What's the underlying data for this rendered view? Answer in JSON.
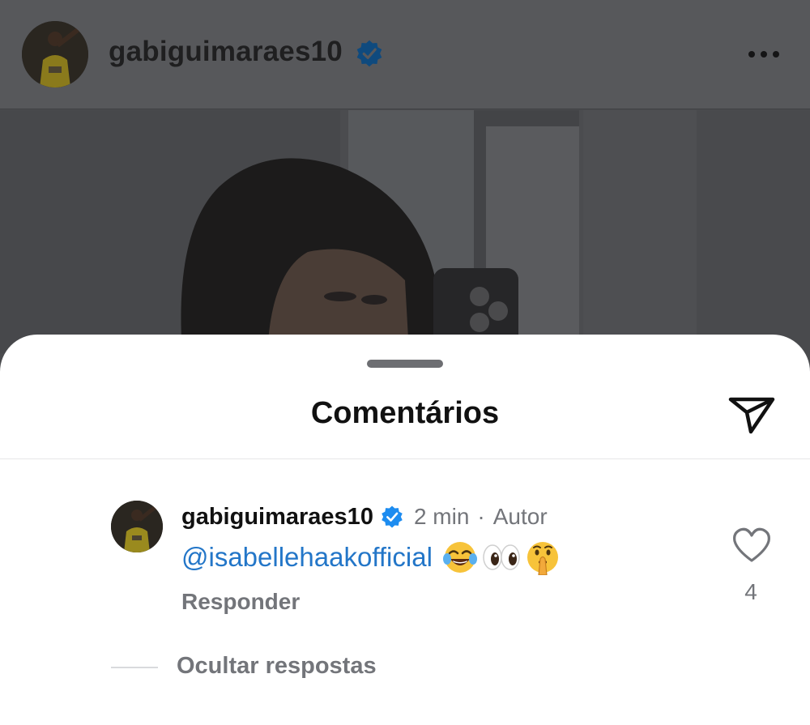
{
  "post": {
    "username": "gabiguimaraes10",
    "more_icon": "more-horizontal-icon"
  },
  "sheet": {
    "title": "Comentários",
    "share_icon": "send-icon"
  },
  "comment": {
    "username": "gabiguimaraes10",
    "time": "2 min",
    "separator": "·",
    "author_badge": "Autor",
    "mention": "@isabellehaakofficial",
    "emojis": [
      "face-with-tears-of-joy",
      "eyes",
      "shushing-face"
    ],
    "reply_label": "Responder",
    "like_count": "4"
  },
  "replies": {
    "toggle_label": "Ocultar respostas"
  },
  "colors": {
    "verified": "#1d8cf0",
    "mention": "#2376c8",
    "secondary_text": "#73757a",
    "scrim": "#4a4b4e"
  }
}
